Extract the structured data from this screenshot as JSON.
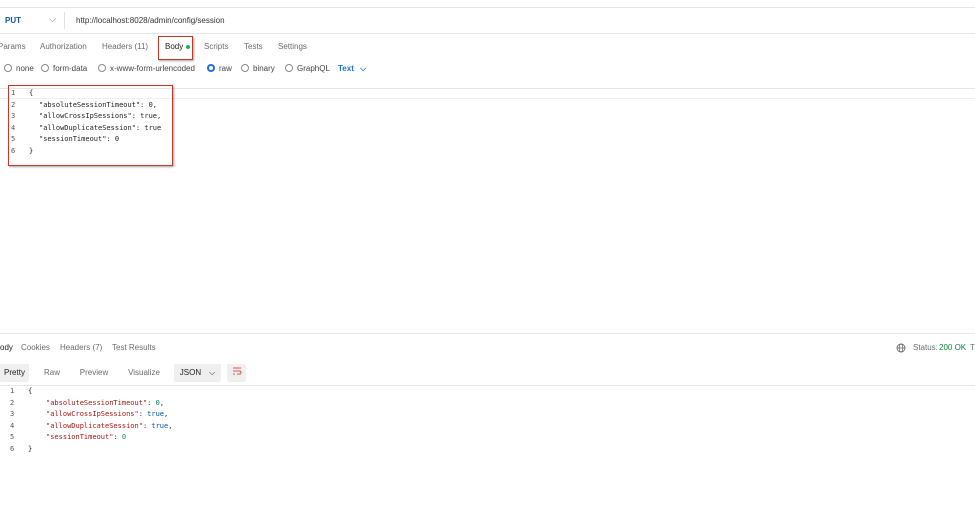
{
  "request": {
    "method": "PUT",
    "url": "http://localhost:8028/admin/config/session"
  },
  "tabs": {
    "params": "Params",
    "authorization": "Authorization",
    "headers": "Headers (11)",
    "body": "Body",
    "scripts": "Scripts",
    "tests": "Tests",
    "settings": "Settings"
  },
  "body_types": {
    "none": "none",
    "form_data": "form-data",
    "urlencoded": "x-www-form-urlencoded",
    "raw": "raw",
    "binary": "binary",
    "graphql": "GraphQL",
    "text": "Text"
  },
  "request_body": {
    "line_numbers": [
      "1",
      "2",
      "3",
      "4",
      "5",
      "6"
    ],
    "lines": [
      "{",
      "\"absoluteSessionTimeout\": 0,",
      "\"allowCrossIpSessions\": true,",
      "\"allowDuplicateSession\": true",
      "\"sessionTimeout\": 0",
      "}"
    ]
  },
  "response": {
    "tabs": {
      "body": "ody",
      "cookies": "Cookies",
      "headers": "Headers (7)",
      "test_results": "Test Results"
    },
    "status_label": "Status:",
    "status_value": "200 OK",
    "status_extra": "T",
    "view_modes": {
      "pretty": "Pretty",
      "raw": "Raw",
      "preview": "Preview",
      "visualize": "Visualize"
    },
    "format": "JSON",
    "line_numbers": [
      "1",
      "2",
      "3",
      "4",
      "5",
      "6"
    ],
    "open_brace": "{",
    "close_brace": "}",
    "entries": [
      {
        "key": "\"absoluteSessionTimeout\"",
        "colon": ": ",
        "value": "0",
        "comma": ",",
        "kind": "num"
      },
      {
        "key": "\"allowCrossIpSessions\"",
        "colon": ": ",
        "value": "true",
        "comma": ",",
        "kind": "bool"
      },
      {
        "key": "\"allowDuplicateSession\"",
        "colon": ": ",
        "value": "true",
        "comma": ",",
        "kind": "bool"
      },
      {
        "key": "\"sessionTimeout\"",
        "colon": ": ",
        "value": "0",
        "comma": "",
        "kind": "num"
      }
    ]
  },
  "icons": {
    "method_dropdown": "chevron-down-icon",
    "text_dropdown": "chevron-down-icon",
    "json_dropdown": "chevron-down-icon",
    "globe": "globe-icon",
    "wrap": "wrap-lines-icon"
  },
  "colors": {
    "method": "#0d5aa7",
    "accent": "#1e6fd9",
    "highlight_box": "#c0392b",
    "status_ok": "#0a8a3a",
    "body_dot": "#0cbb52"
  }
}
